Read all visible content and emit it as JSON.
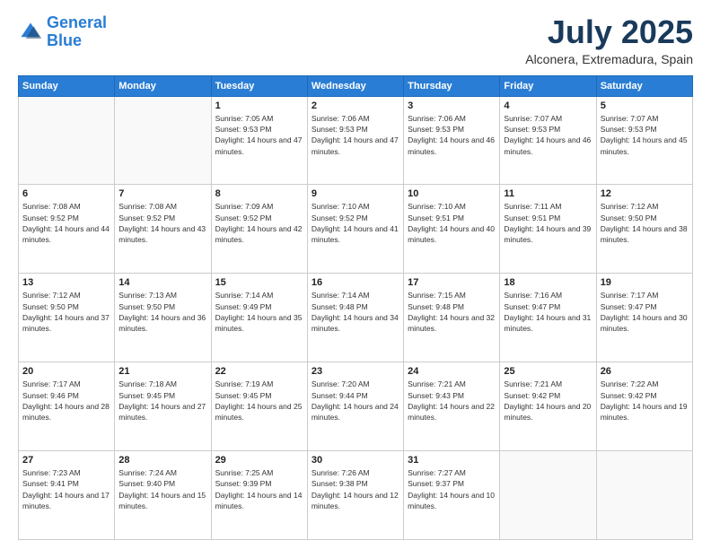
{
  "logo": {
    "line1": "General",
    "line2": "Blue"
  },
  "header": {
    "month": "July 2025",
    "location": "Alconera, Extremadura, Spain"
  },
  "weekdays": [
    "Sunday",
    "Monday",
    "Tuesday",
    "Wednesday",
    "Thursday",
    "Friday",
    "Saturday"
  ],
  "weeks": [
    [
      {
        "day": "",
        "sunrise": "",
        "sunset": "",
        "daylight": ""
      },
      {
        "day": "",
        "sunrise": "",
        "sunset": "",
        "daylight": ""
      },
      {
        "day": "1",
        "sunrise": "Sunrise: 7:05 AM",
        "sunset": "Sunset: 9:53 PM",
        "daylight": "Daylight: 14 hours and 47 minutes."
      },
      {
        "day": "2",
        "sunrise": "Sunrise: 7:06 AM",
        "sunset": "Sunset: 9:53 PM",
        "daylight": "Daylight: 14 hours and 47 minutes."
      },
      {
        "day": "3",
        "sunrise": "Sunrise: 7:06 AM",
        "sunset": "Sunset: 9:53 PM",
        "daylight": "Daylight: 14 hours and 46 minutes."
      },
      {
        "day": "4",
        "sunrise": "Sunrise: 7:07 AM",
        "sunset": "Sunset: 9:53 PM",
        "daylight": "Daylight: 14 hours and 46 minutes."
      },
      {
        "day": "5",
        "sunrise": "Sunrise: 7:07 AM",
        "sunset": "Sunset: 9:53 PM",
        "daylight": "Daylight: 14 hours and 45 minutes."
      }
    ],
    [
      {
        "day": "6",
        "sunrise": "Sunrise: 7:08 AM",
        "sunset": "Sunset: 9:52 PM",
        "daylight": "Daylight: 14 hours and 44 minutes."
      },
      {
        "day": "7",
        "sunrise": "Sunrise: 7:08 AM",
        "sunset": "Sunset: 9:52 PM",
        "daylight": "Daylight: 14 hours and 43 minutes."
      },
      {
        "day": "8",
        "sunrise": "Sunrise: 7:09 AM",
        "sunset": "Sunset: 9:52 PM",
        "daylight": "Daylight: 14 hours and 42 minutes."
      },
      {
        "day": "9",
        "sunrise": "Sunrise: 7:10 AM",
        "sunset": "Sunset: 9:52 PM",
        "daylight": "Daylight: 14 hours and 41 minutes."
      },
      {
        "day": "10",
        "sunrise": "Sunrise: 7:10 AM",
        "sunset": "Sunset: 9:51 PM",
        "daylight": "Daylight: 14 hours and 40 minutes."
      },
      {
        "day": "11",
        "sunrise": "Sunrise: 7:11 AM",
        "sunset": "Sunset: 9:51 PM",
        "daylight": "Daylight: 14 hours and 39 minutes."
      },
      {
        "day": "12",
        "sunrise": "Sunrise: 7:12 AM",
        "sunset": "Sunset: 9:50 PM",
        "daylight": "Daylight: 14 hours and 38 minutes."
      }
    ],
    [
      {
        "day": "13",
        "sunrise": "Sunrise: 7:12 AM",
        "sunset": "Sunset: 9:50 PM",
        "daylight": "Daylight: 14 hours and 37 minutes."
      },
      {
        "day": "14",
        "sunrise": "Sunrise: 7:13 AM",
        "sunset": "Sunset: 9:50 PM",
        "daylight": "Daylight: 14 hours and 36 minutes."
      },
      {
        "day": "15",
        "sunrise": "Sunrise: 7:14 AM",
        "sunset": "Sunset: 9:49 PM",
        "daylight": "Daylight: 14 hours and 35 minutes."
      },
      {
        "day": "16",
        "sunrise": "Sunrise: 7:14 AM",
        "sunset": "Sunset: 9:48 PM",
        "daylight": "Daylight: 14 hours and 34 minutes."
      },
      {
        "day": "17",
        "sunrise": "Sunrise: 7:15 AM",
        "sunset": "Sunset: 9:48 PM",
        "daylight": "Daylight: 14 hours and 32 minutes."
      },
      {
        "day": "18",
        "sunrise": "Sunrise: 7:16 AM",
        "sunset": "Sunset: 9:47 PM",
        "daylight": "Daylight: 14 hours and 31 minutes."
      },
      {
        "day": "19",
        "sunrise": "Sunrise: 7:17 AM",
        "sunset": "Sunset: 9:47 PM",
        "daylight": "Daylight: 14 hours and 30 minutes."
      }
    ],
    [
      {
        "day": "20",
        "sunrise": "Sunrise: 7:17 AM",
        "sunset": "Sunset: 9:46 PM",
        "daylight": "Daylight: 14 hours and 28 minutes."
      },
      {
        "day": "21",
        "sunrise": "Sunrise: 7:18 AM",
        "sunset": "Sunset: 9:45 PM",
        "daylight": "Daylight: 14 hours and 27 minutes."
      },
      {
        "day": "22",
        "sunrise": "Sunrise: 7:19 AM",
        "sunset": "Sunset: 9:45 PM",
        "daylight": "Daylight: 14 hours and 25 minutes."
      },
      {
        "day": "23",
        "sunrise": "Sunrise: 7:20 AM",
        "sunset": "Sunset: 9:44 PM",
        "daylight": "Daylight: 14 hours and 24 minutes."
      },
      {
        "day": "24",
        "sunrise": "Sunrise: 7:21 AM",
        "sunset": "Sunset: 9:43 PM",
        "daylight": "Daylight: 14 hours and 22 minutes."
      },
      {
        "day": "25",
        "sunrise": "Sunrise: 7:21 AM",
        "sunset": "Sunset: 9:42 PM",
        "daylight": "Daylight: 14 hours and 20 minutes."
      },
      {
        "day": "26",
        "sunrise": "Sunrise: 7:22 AM",
        "sunset": "Sunset: 9:42 PM",
        "daylight": "Daylight: 14 hours and 19 minutes."
      }
    ],
    [
      {
        "day": "27",
        "sunrise": "Sunrise: 7:23 AM",
        "sunset": "Sunset: 9:41 PM",
        "daylight": "Daylight: 14 hours and 17 minutes."
      },
      {
        "day": "28",
        "sunrise": "Sunrise: 7:24 AM",
        "sunset": "Sunset: 9:40 PM",
        "daylight": "Daylight: 14 hours and 15 minutes."
      },
      {
        "day": "29",
        "sunrise": "Sunrise: 7:25 AM",
        "sunset": "Sunset: 9:39 PM",
        "daylight": "Daylight: 14 hours and 14 minutes."
      },
      {
        "day": "30",
        "sunrise": "Sunrise: 7:26 AM",
        "sunset": "Sunset: 9:38 PM",
        "daylight": "Daylight: 14 hours and 12 minutes."
      },
      {
        "day": "31",
        "sunrise": "Sunrise: 7:27 AM",
        "sunset": "Sunset: 9:37 PM",
        "daylight": "Daylight: 14 hours and 10 minutes."
      },
      {
        "day": "",
        "sunrise": "",
        "sunset": "",
        "daylight": ""
      },
      {
        "day": "",
        "sunrise": "",
        "sunset": "",
        "daylight": ""
      }
    ]
  ]
}
